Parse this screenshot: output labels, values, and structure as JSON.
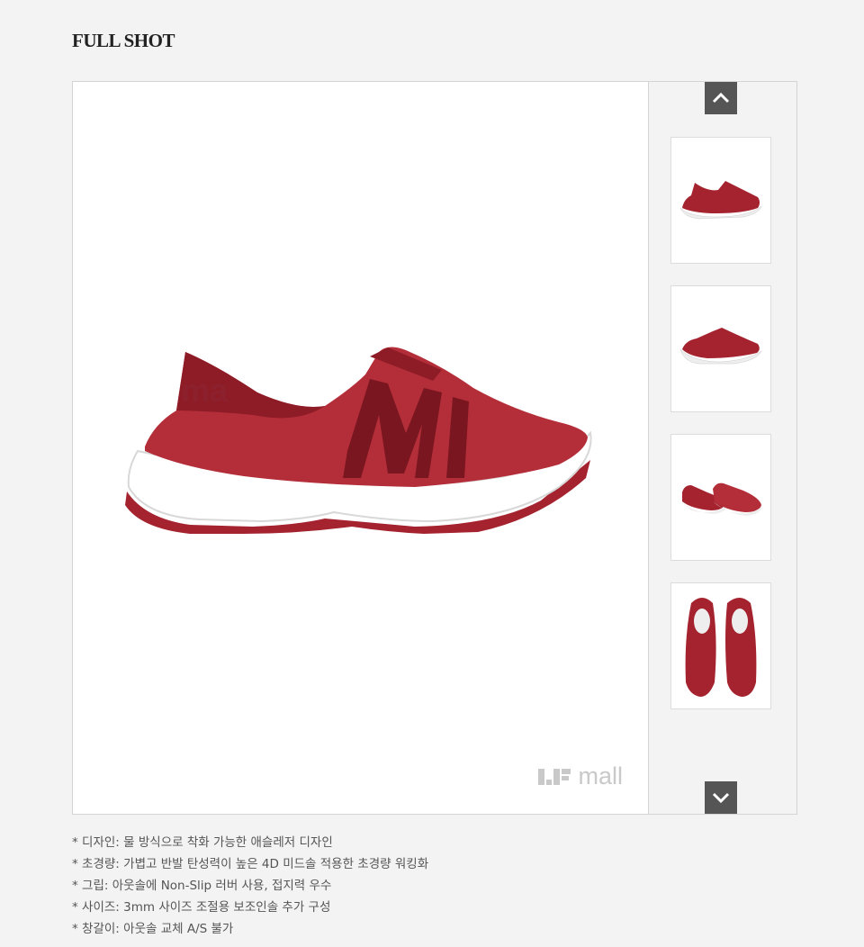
{
  "section": {
    "title": "FULL SHOT"
  },
  "viewer": {
    "watermark_text": "mall",
    "thumbnails": [
      {
        "name": "thumb-side-view",
        "icon": "shoe-side-icon"
      },
      {
        "name": "thumb-angle-view",
        "icon": "shoe-angle-icon"
      },
      {
        "name": "thumb-pair-view",
        "icon": "shoe-pair-icon"
      },
      {
        "name": "thumb-top-view",
        "icon": "shoe-top-icon"
      }
    ],
    "colors": {
      "shoe": "#a5232f",
      "shoe_dark": "#7a1620",
      "sole": "#ffffff",
      "button": "#555555"
    }
  },
  "description": [
    "디자인: 물 방식으로 착화 가능한 애슬레저 디자인",
    "초경량: 가볍고 반발 탄성력이 높은 4D 미드솔 적용한 초경량 워킹화",
    "그립: 아웃솔에 Non-Slip 러버 사용, 접지력 우수",
    "사이즈: 3mm 사이즈 조절용 보조인솔 추가 구성",
    "창갈이: 아웃솔 교체 A/S 불가"
  ]
}
